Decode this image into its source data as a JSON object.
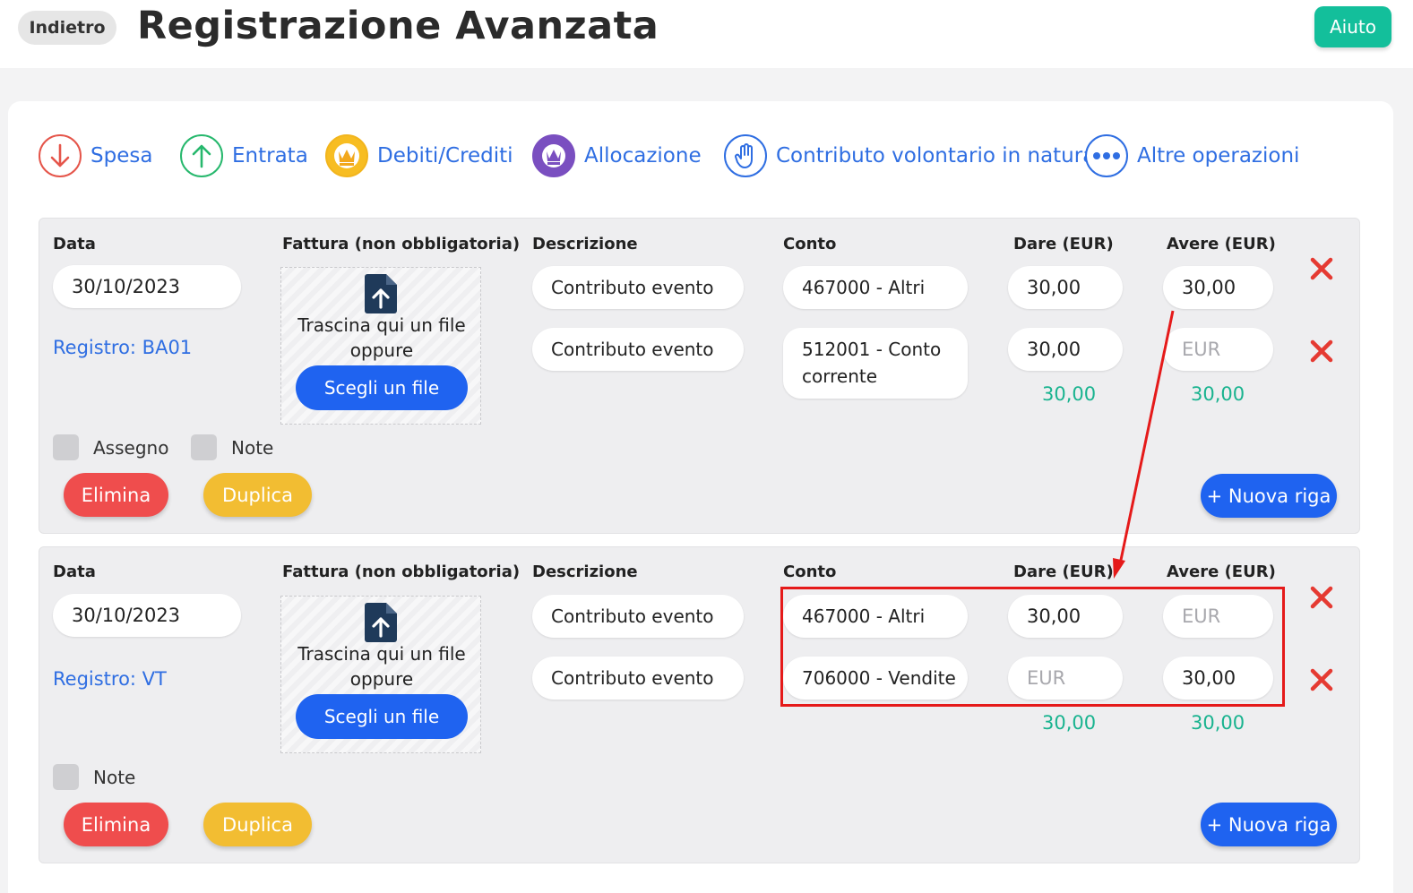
{
  "header": {
    "back_label": "Indietro",
    "title": "Registrazione Avanzata",
    "help_label": "Aiuto"
  },
  "operations": [
    {
      "label": "Spesa",
      "icon": "arrow-down-icon",
      "color": "#e5554a"
    },
    {
      "label": "Entrata",
      "icon": "arrow-up-icon",
      "color": "#27b86d"
    },
    {
      "label": "Debiti/Crediti",
      "icon": "crown-icon",
      "color": "#f2b51d"
    },
    {
      "label": "Allocazione",
      "icon": "crown-arrows-icon",
      "color": "#7a4fc0"
    },
    {
      "label": "Contributo volontario in natura",
      "icon": "hand-icon",
      "color": "#2f6ee2"
    },
    {
      "label": "Altre operazioni",
      "icon": "more-dots-icon",
      "color": "#2f6ee2"
    }
  ],
  "columns": {
    "data": "Data",
    "fattura": "Fattura (non obbligatoria)",
    "descrizione": "Descrizione",
    "conto": "Conto",
    "dare": "Dare (EUR)",
    "avere": "Avere (EUR)"
  },
  "upload": {
    "drop_text_line1": "Trascina qui un file",
    "drop_text_line2": "oppure",
    "choose_label": "Scegli un file"
  },
  "amount_placeholder": "EUR",
  "entries": [
    {
      "date": "30/10/2023",
      "registro": "Registro: BA01",
      "rows": [
        {
          "descrizione": "Contributo evento",
          "conto": "467000 - Altri",
          "dare": "30,00",
          "avere": "30,00"
        },
        {
          "descrizione": "Contributo evento",
          "conto": "512001 - Conto corrente",
          "dare": "30,00",
          "avere": ""
        }
      ],
      "total_dare": "30,00",
      "total_avere": "30,00",
      "checks": [
        "Assegno",
        "Note"
      ],
      "delete_label": "Elimina",
      "duplicate_label": "Duplica",
      "new_row_label": "+ Nuova riga"
    },
    {
      "date": "30/10/2023",
      "registro": "Registro: VT",
      "rows": [
        {
          "descrizione": "Contributo evento",
          "conto": "467000 - Altri",
          "dare": "30,00",
          "avere": ""
        },
        {
          "descrizione": "Contributo evento",
          "conto": "706000 - Vendite",
          "dare": "",
          "avere": "30,00"
        }
      ],
      "total_dare": "30,00",
      "total_avere": "30,00",
      "checks": [
        "Note"
      ],
      "delete_label": "Elimina",
      "duplicate_label": "Duplica",
      "new_row_label": "+ Nuova riga"
    }
  ],
  "colors": {
    "accent_blue": "#1f63f0",
    "link_blue": "#2f6ee2",
    "help_green": "#13bf9b",
    "total_green": "#19b38f",
    "delete_red": "#ef4d4d",
    "duplicate_yellow": "#f2bd32",
    "annotation_red": "#e51a1a"
  }
}
